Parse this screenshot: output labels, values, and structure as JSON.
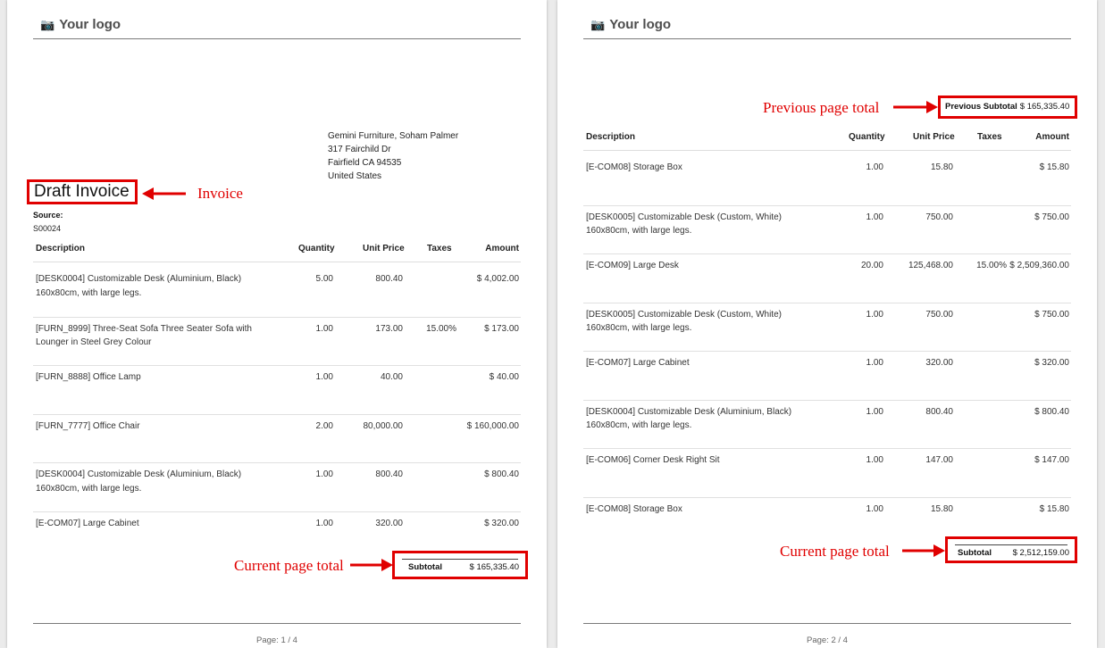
{
  "logo_text": "Your logo",
  "address_lines": [
    "Gemini Furniture, Soham Palmer",
    "317 Fairchild Dr",
    "Fairfield CA 94535",
    "United States"
  ],
  "invoice_title": "Draft Invoice",
  "source_label": "Source:",
  "source_value": "S00024",
  "columns": [
    "Description",
    "Quantity",
    "Unit Price",
    "Taxes",
    "Amount"
  ],
  "page1": {
    "rows": [
      {
        "desc": "[DESK0004] Customizable Desk (Aluminium, Black) 160x80cm, with large legs.",
        "qty": "5.00",
        "price": "800.40",
        "tax": "",
        "amount": "$ 4,002.00"
      },
      {
        "desc": "[FURN_8999] Three-Seat Sofa Three Seater Sofa with Lounger in Steel Grey Colour",
        "qty": "1.00",
        "price": "173.00",
        "tax": "15.00%",
        "amount": "$ 173.00"
      },
      {
        "desc": "[FURN_8888] Office Lamp",
        "qty": "1.00",
        "price": "40.00",
        "tax": "",
        "amount": "$ 40.00"
      },
      {
        "desc": "[FURN_7777] Office Chair",
        "qty": "2.00",
        "price": "80,000.00",
        "tax": "",
        "amount": "$ 160,000.00"
      },
      {
        "desc": "[DESK0004] Customizable Desk (Aluminium, Black) 160x80cm, with large legs.",
        "qty": "1.00",
        "price": "800.40",
        "tax": "",
        "amount": "$ 800.40"
      },
      {
        "desc": "[E-COM07] Large Cabinet",
        "qty": "1.00",
        "price": "320.00",
        "tax": "",
        "amount": "$ 320.00"
      }
    ],
    "subtotal_label": "Subtotal",
    "subtotal_value": "$ 165,335.40",
    "footer": "Page: 1 / 4"
  },
  "page2": {
    "prev_label": "Previous Subtotal",
    "prev_value": "$ 165,335.40",
    "rows": [
      {
        "desc": "[E-COM08] Storage Box",
        "qty": "1.00",
        "price": "15.80",
        "tax": "",
        "amount": "$ 15.80"
      },
      {
        "desc": "[DESK0005] Customizable Desk (Custom, White) 160x80cm, with large legs.",
        "qty": "1.00",
        "price": "750.00",
        "tax": "",
        "amount": "$ 750.00"
      },
      {
        "desc": "[E-COM09] Large Desk",
        "qty": "20.00",
        "price": "125,468.00",
        "tax": "15.00%",
        "amount": "$ 2,509,360.00"
      },
      {
        "desc": "[DESK0005] Customizable Desk (Custom, White) 160x80cm, with large legs.",
        "qty": "1.00",
        "price": "750.00",
        "tax": "",
        "amount": "$ 750.00"
      },
      {
        "desc": "[E-COM07] Large Cabinet",
        "qty": "1.00",
        "price": "320.00",
        "tax": "",
        "amount": "$ 320.00"
      },
      {
        "desc": "[DESK0004] Customizable Desk (Aluminium, Black) 160x80cm, with large legs.",
        "qty": "1.00",
        "price": "800.40",
        "tax": "",
        "amount": "$ 800.40"
      },
      {
        "desc": "[E-COM06] Corner Desk Right Sit",
        "qty": "1.00",
        "price": "147.00",
        "tax": "",
        "amount": "$ 147.00"
      },
      {
        "desc": "[E-COM08] Storage Box",
        "qty": "1.00",
        "price": "15.80",
        "tax": "",
        "amount": "$ 15.80"
      }
    ],
    "subtotal_label": "Subtotal",
    "subtotal_value": "$ 2,512,159.00",
    "footer": "Page: 2 / 4"
  },
  "annotations": {
    "invoice": "Invoice",
    "current_page_total": "Current page total",
    "previous_page_total": "Previous page total"
  },
  "colors": {
    "annotation": "#e00000"
  }
}
